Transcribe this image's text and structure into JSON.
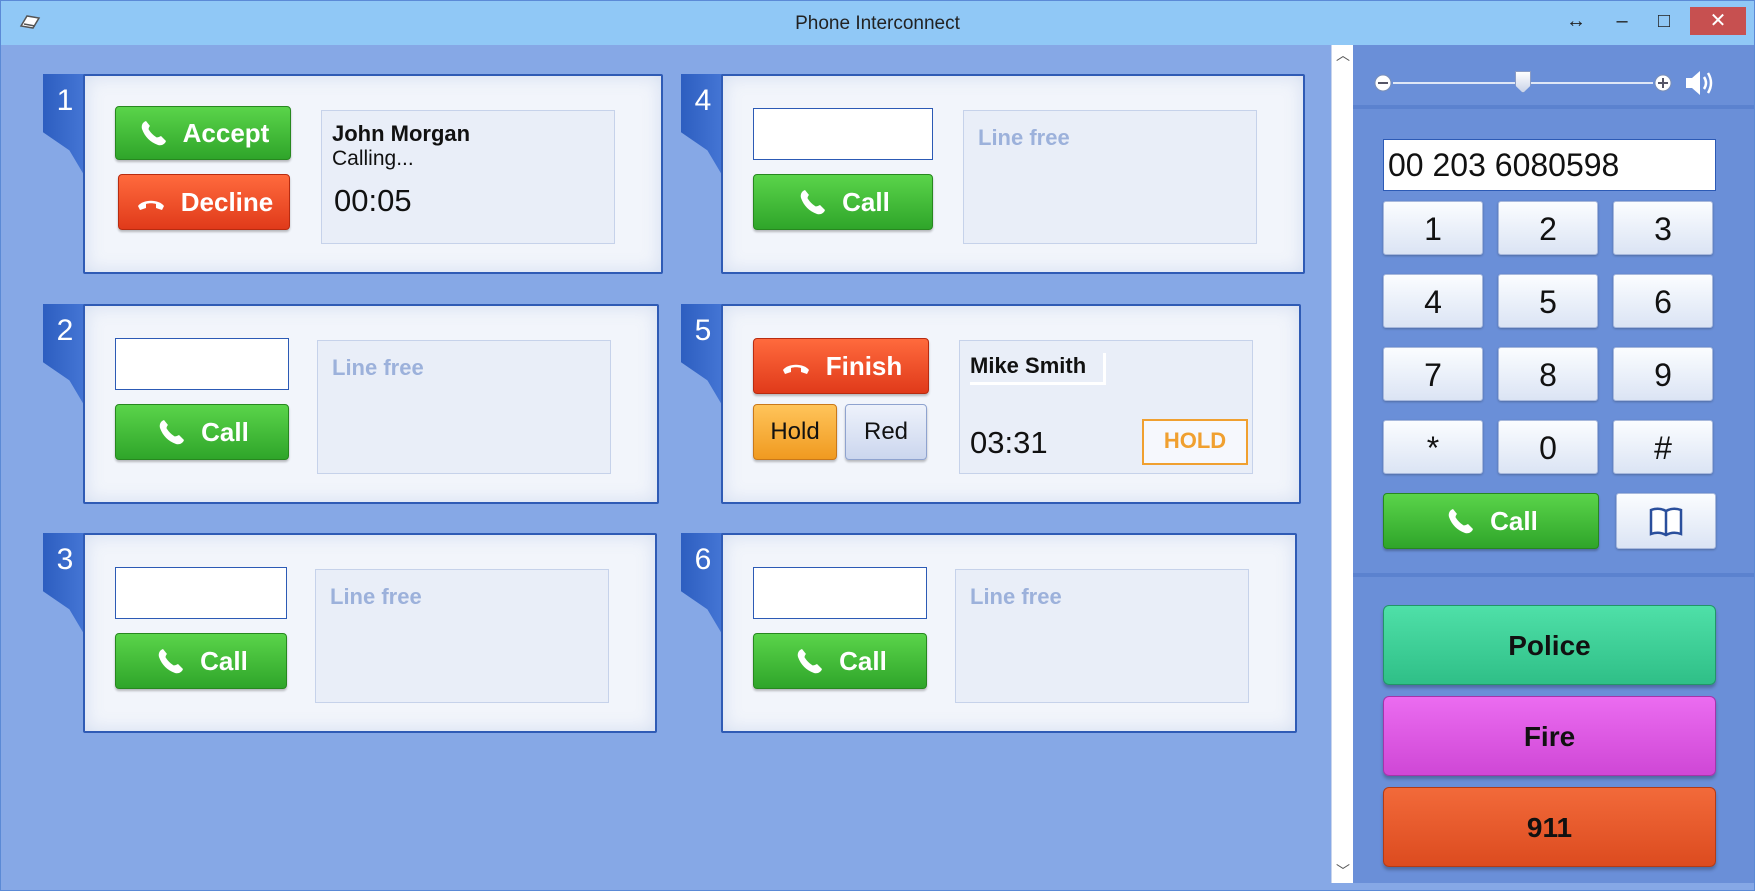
{
  "window": {
    "title": "Phone Interconnect",
    "restore_glyph": "↔",
    "minimize_glyph": "–",
    "maximize_glyph": "□",
    "close_glyph": "✕"
  },
  "colors": {
    "accent_blue": "#2f5bb5",
    "green": "#3cb935",
    "red": "#e8461f",
    "hold_orange": "#f0a030",
    "police": "#3ecf9a",
    "fire": "#dd5ae2",
    "emergency911": "#e85a2b"
  },
  "lines": [
    {
      "number": "1",
      "state": "incoming",
      "accept_label": "Accept",
      "decline_label": "Decline",
      "caller_name": "John Morgan",
      "status": "Calling...",
      "timer": "00:05"
    },
    {
      "number": "2",
      "state": "free",
      "call_label": "Call",
      "input_value": "",
      "status": "Line free"
    },
    {
      "number": "3",
      "state": "free",
      "call_label": "Call",
      "input_value": "",
      "status": "Line free"
    },
    {
      "number": "4",
      "state": "free",
      "call_label": "Call",
      "input_value": "",
      "status": "Line free"
    },
    {
      "number": "5",
      "state": "active",
      "finish_label": "Finish",
      "hold_label": "Hold",
      "redirect_label": "Red",
      "caller_name": "Mike Smith",
      "timer": "03:31",
      "hold_badge": "HOLD"
    },
    {
      "number": "6",
      "state": "free",
      "call_label": "Call",
      "input_value": "",
      "status": "Line free"
    }
  ],
  "dialer": {
    "volume_level": 0.5,
    "number_value": "00 203 6080598",
    "keys": [
      "1",
      "2",
      "3",
      "4",
      "5",
      "6",
      "7",
      "8",
      "9",
      "*",
      "0",
      "#"
    ],
    "call_label": "Call",
    "phonebook_icon": "book-icon"
  },
  "emergency": {
    "police_label": "Police",
    "fire_label": "Fire",
    "emergency_label": "911"
  }
}
